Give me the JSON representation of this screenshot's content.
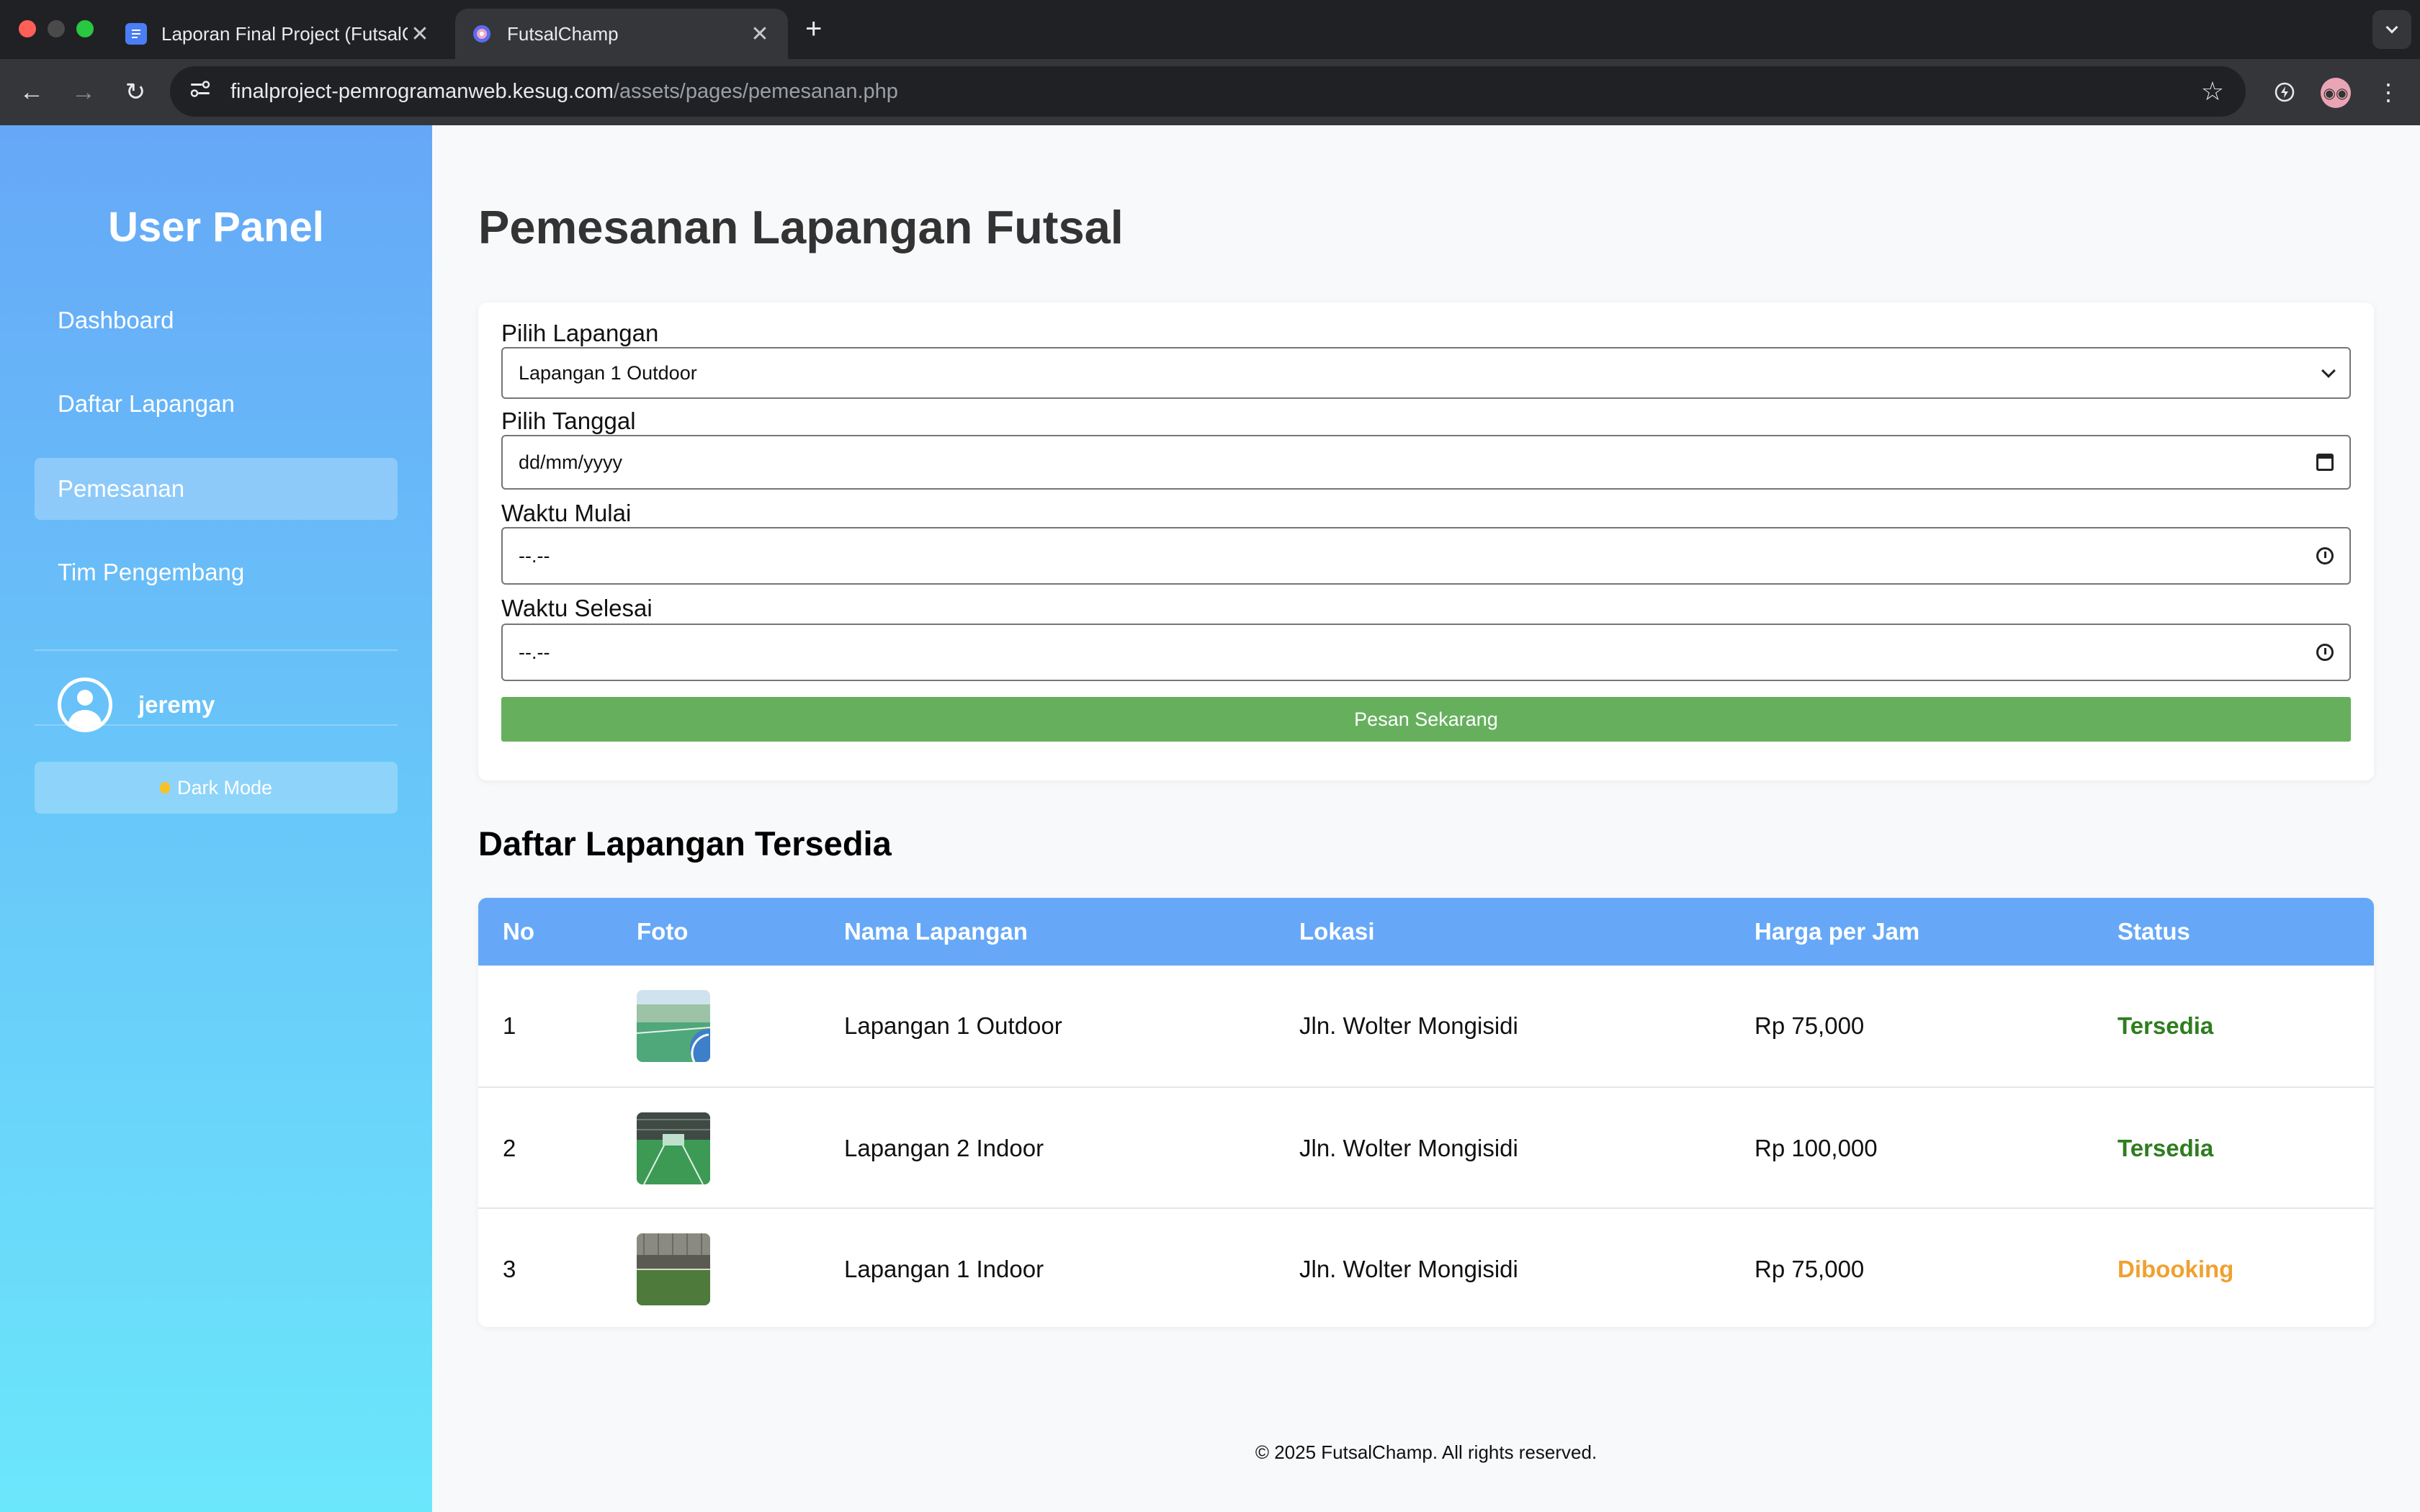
{
  "browser": {
    "tabs": [
      {
        "title": "Laporan Final Project (FutsalC",
        "close": "✕"
      },
      {
        "title": "FutsalChamp",
        "close": "✕"
      }
    ],
    "new_tab": "+",
    "url_host": "finalproject-pemrogramanweb.kesug.com",
    "url_path": "/assets/pages/pemesanan.php"
  },
  "sidebar": {
    "title": "User Panel",
    "items": [
      {
        "label": "Dashboard"
      },
      {
        "label": "Daftar Lapangan"
      },
      {
        "label": "Pemesanan"
      },
      {
        "label": "Tim Pengembang"
      }
    ],
    "username": "jeremy",
    "dark_mode_label": "Dark Mode"
  },
  "page": {
    "title": "Pemesanan Lapangan Futsal"
  },
  "form": {
    "field_label": "Pilih Lapangan",
    "field_value": "Lapangan 1 Outdoor",
    "date_label": "Pilih Tanggal",
    "date_value": "dd/mm/yyyy",
    "start_label": "Waktu Mulai",
    "start_value": "--.--",
    "end_label": "Waktu Selesai",
    "end_value": "--.--",
    "submit_label": "Pesan Sekarang"
  },
  "table": {
    "title": "Daftar Lapangan Tersedia",
    "headers": [
      "No",
      "Foto",
      "Nama Lapangan",
      "Lokasi",
      "Harga per Jam",
      "Status"
    ],
    "rows": [
      {
        "no": "1",
        "name": "Lapangan 1 Outdoor",
        "location": "Jln. Wolter Mongisidi",
        "price": "Rp 75,000",
        "status": "Tersedia",
        "status_color": "#2e7d1f"
      },
      {
        "no": "2",
        "name": "Lapangan 2 Indoor",
        "location": "Jln. Wolter Mongisidi",
        "price": "Rp 100,000",
        "status": "Tersedia",
        "status_color": "#2e7d1f"
      },
      {
        "no": "3",
        "name": "Lapangan 1 Indoor",
        "location": "Jln. Wolter Mongisidi",
        "price": "Rp 75,000",
        "status": "Dibooking",
        "status_color": "#f0a130"
      }
    ]
  },
  "footer": {
    "text": "© 2025 FutsalChamp. All rights reserved."
  },
  "colors": {
    "sidebar_top": "#66a8f7",
    "sidebar_bottom": "#6be7fb",
    "table_header": "#66a8f7",
    "submit_button": "#66b05d"
  }
}
